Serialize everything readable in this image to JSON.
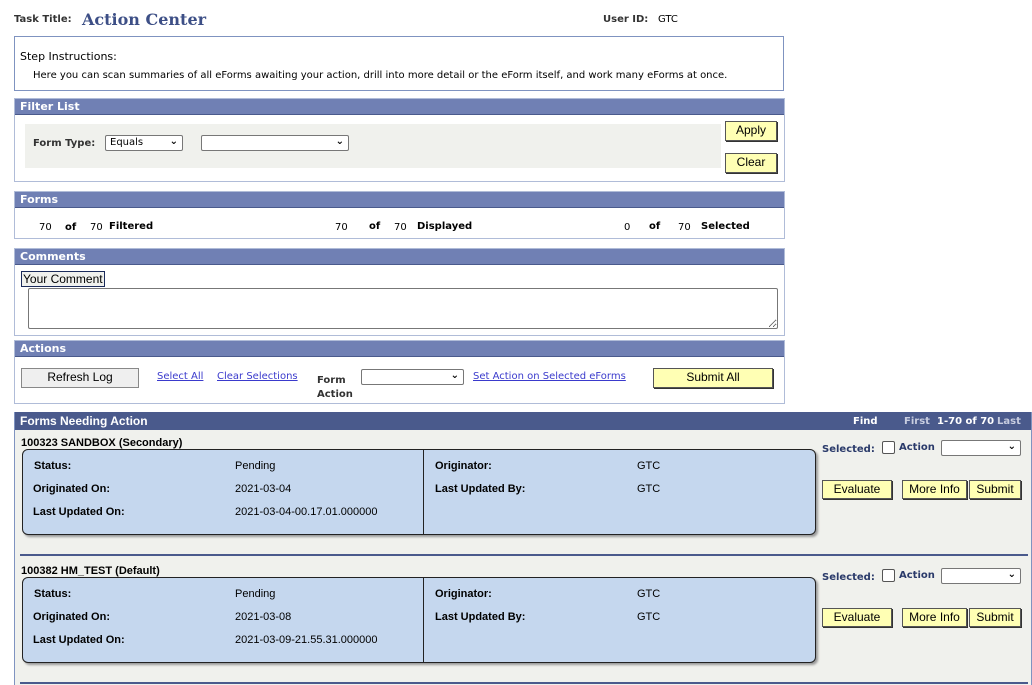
{
  "header": {
    "task_title_label": "Task Title:",
    "task_title": "Action Center",
    "user_id_label": "User ID:",
    "user_id": "GTC"
  },
  "instructions": {
    "heading": "Step Instructions:",
    "text": "Here you can scan summaries of all eForms awaiting your action, drill into more detail or the eForm itself, and work many eForms at once."
  },
  "filter": {
    "title": "Filter List",
    "form_type_label": "Form Type:",
    "operator": "Equals",
    "value": "",
    "apply": "Apply",
    "clear": "Clear"
  },
  "forms": {
    "title": "Forms",
    "filtered": "70",
    "filtered_total": "70",
    "filtered_label": "Filtered",
    "displayed": "70",
    "displayed_total": "70",
    "displayed_label": "Displayed",
    "selected": "0",
    "selected_total": "70",
    "selected_label": "Selected",
    "of": "of"
  },
  "comments": {
    "title": "Comments",
    "label": "Your Comment",
    "value": ""
  },
  "actions": {
    "title": "Actions",
    "refresh": "Refresh Log",
    "select_all": "Select All",
    "clear_selections": "Clear Selections",
    "form_action_label_1": "Form",
    "form_action_label_2": "Action",
    "form_action_value": "",
    "set_action": "Set Action on Selected eForms",
    "submit_all": "Submit All"
  },
  "needing": {
    "title": "Forms Needing Action",
    "find": "Find",
    "first": "First",
    "range": "1-70 of 70",
    "last": "Last",
    "labels": {
      "status": "Status:",
      "originated_on": "Originated On:",
      "last_updated_on": "Last Updated On:",
      "originator": "Originator:",
      "last_updated_by": "Last Updated By:",
      "selected": "Selected:",
      "action": "Action",
      "evaluate": "Evaluate",
      "more_info": "More Info",
      "submit": "Submit"
    },
    "items": [
      {
        "title": "100323  SANDBOX (Secondary)",
        "status": "Pending",
        "originated_on": "2021-03-04",
        "last_updated_on": "2021-03-04-00.17.01.000000",
        "originator": "GTC",
        "last_updated_by": "GTC",
        "selected": false,
        "action": ""
      },
      {
        "title": "100382  HM_TEST (Default)",
        "status": "Pending",
        "originated_on": "2021-03-08",
        "last_updated_on": "2021-03-09-21.55.31.000000",
        "originator": "GTC",
        "last_updated_by": "GTC",
        "selected": false,
        "action": ""
      }
    ]
  },
  "colors": {
    "section_header": "#7080b4",
    "grid_header": "#4a5a8c",
    "card": "#c5d7ee",
    "button": "#ffffb4"
  }
}
